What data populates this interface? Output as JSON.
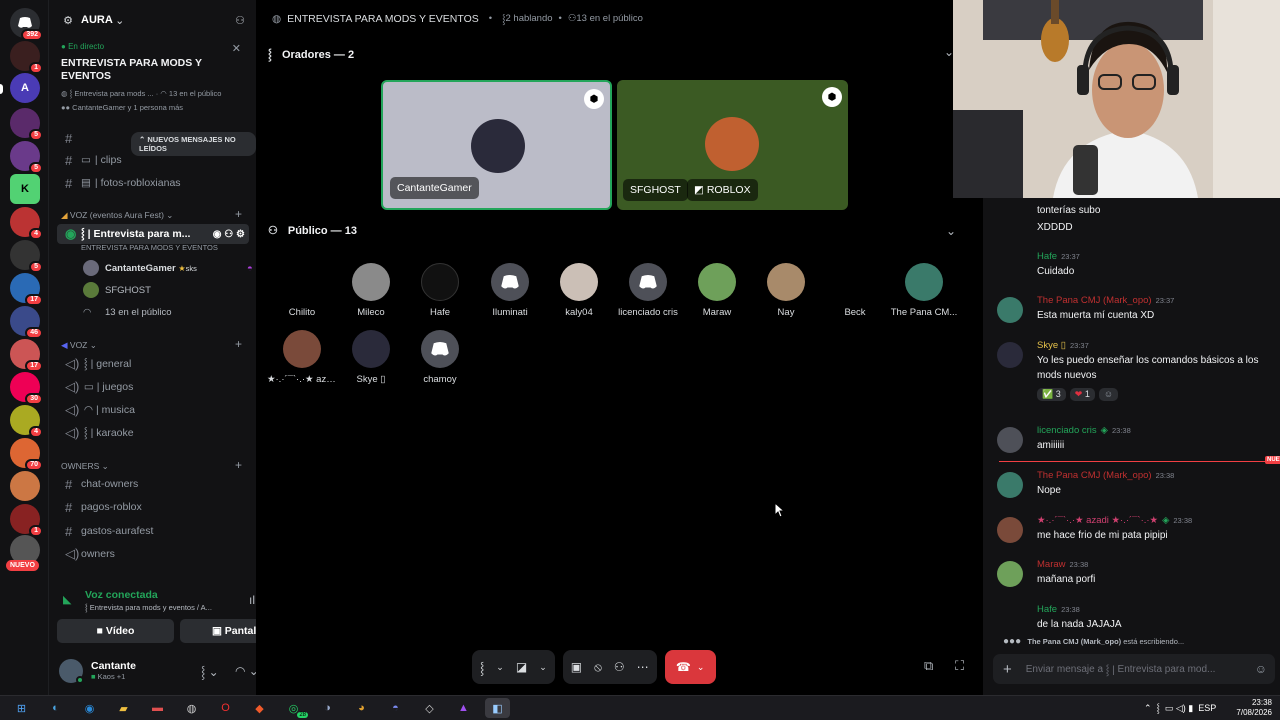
{
  "rail": {
    "dm_badge": "392",
    "badges": [
      "1",
      "5",
      "5",
      "4",
      "5",
      "17",
      "46",
      "17",
      "30",
      "4",
      "70",
      "1"
    ],
    "new_label": "NUEVO"
  },
  "server": {
    "name": "AURA"
  },
  "event": {
    "live_label": "En directo",
    "title": "ENTREVISTA PARA MODS Y EVENTOS",
    "sub": "Entrevista para mods ...",
    "audience": "13 en el público",
    "speakers_line": "CantanteGamer y 1 persona más"
  },
  "sidebar": {
    "unread_label": "NUEVOS MENSAJES NO LEÍDOS",
    "channels": [
      {
        "label": "clips"
      },
      {
        "label": "fotos-robloxianas"
      }
    ],
    "voz_events_cat": "VOZ (eventos Aura Fest)",
    "stage_channel": {
      "label": "Entrevista para m...",
      "sub": "ENTREVISTA PARA MODS Y EVENTOS"
    },
    "stage_users": [
      {
        "name": "CantanteGamer",
        "tag": "sks"
      },
      {
        "name": "SFGHOST"
      }
    ],
    "stage_audience": "13 en el público",
    "voz_cat": "VOZ",
    "voice_channels": [
      {
        "label": "general"
      },
      {
        "label": "juegos"
      },
      {
        "label": "musica"
      },
      {
        "label": "karaoke"
      }
    ],
    "owners_cat": "OWNERS",
    "owner_channels": [
      {
        "label": "chat-owners"
      },
      {
        "label": "pagos-roblox"
      },
      {
        "label": "gastos-aurafest"
      },
      {
        "label": "owners"
      }
    ]
  },
  "voice_panel": {
    "status": "Voz conectada",
    "channel": "Entrevista para mods y eventos / A...",
    "video": "Vídeo",
    "screen": "Pantalla"
  },
  "user": {
    "name": "Cantante",
    "status": "Kaos +1"
  },
  "stage": {
    "title": "ENTREVISTA PARA MODS Y EVENTOS",
    "speaking": "2 hablando",
    "audience_count": "13 en el público",
    "speakers_heading": "Oradores — 2",
    "speakers": [
      {
        "name": "CantanteGamer"
      },
      {
        "name": "SFGHOST",
        "extra": "ROBLOX"
      }
    ],
    "audience_heading": "Público — 13",
    "audience": [
      {
        "name": "Chilito"
      },
      {
        "name": "Mileco"
      },
      {
        "name": "Hafe"
      },
      {
        "name": "Iluminati"
      },
      {
        "name": "kaly04"
      },
      {
        "name": "licenciado cris"
      },
      {
        "name": "Maraw"
      },
      {
        "name": "Nay"
      },
      {
        "name": "Beck"
      },
      {
        "name": "The Pana CM..."
      },
      {
        "name": "★·.·´¯`·.·★ azad..."
      },
      {
        "name": "Skye ▯"
      },
      {
        "name": "chamoy"
      }
    ]
  },
  "chat": {
    "messages": [
      {
        "author": "",
        "time": "",
        "text": "tonterías subo"
      },
      {
        "author": "",
        "time": "",
        "text": "XDDDD"
      },
      {
        "author": "Hafe",
        "time": "23:37",
        "text": "Cuidado"
      },
      {
        "author": "The Pana CMJ (Mark_opo)",
        "time": "23:37",
        "text": "Esta muerta mí cuenta XD"
      },
      {
        "author": "Skye ▯",
        "time": "23:37",
        "text": "Yo les puedo enseñar los comandos básicos a los mods nuevos"
      },
      {
        "author": "licenciado cris",
        "time": "23:38",
        "text": "amiiiiii"
      },
      {
        "author": "The Pana CMJ (Mark_opo)",
        "time": "23:38",
        "text": "Nope"
      },
      {
        "author": "★·.·´¯`·.·★ azadi ★·.·´¯`·.·★",
        "time": "23:38",
        "text": "me hace frio de mi pata pipipi"
      },
      {
        "author": "Maraw",
        "time": "23:38",
        "text": "mañana porfi"
      },
      {
        "author": "Hafe",
        "time": "23:38",
        "text": "de la nada JAJAJA"
      }
    ],
    "reactions": [
      {
        "emoji": "✅",
        "count": "3"
      },
      {
        "emoji": "❤",
        "count": "1"
      }
    ],
    "new_marker": "NUEVO",
    "typing_user": "The Pana CMJ (Mark_opo)",
    "typing_text": "está escribiendo...",
    "placeholder": "Enviar mensaje a",
    "placeholder_channel": "Entrevista para mod..."
  },
  "taskbar": {
    "lang": "ESP",
    "time": "23:38",
    "date": "7/08/2026",
    "whatsapp_badge": "28"
  }
}
